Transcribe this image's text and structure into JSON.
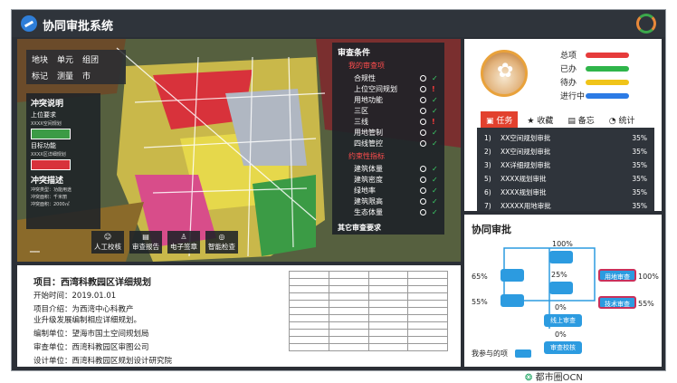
{
  "app": {
    "title": "协同审批系统"
  },
  "map_toolbox": {
    "row1": [
      "地块",
      "单元",
      "组团"
    ],
    "row2": [
      "标记",
      "测量",
      "市"
    ]
  },
  "conflict": {
    "title": "冲突说明",
    "upper_label": "上位要求",
    "upper_sub": "XXXX空间规划",
    "target_label": "目标功能",
    "target_sub": "XXXX区详细规划",
    "desc_label": "冲突描述",
    "desc_lines": [
      "冲突类型：功能用途",
      "冲突面积：千米丽",
      "冲突面积：2000㎡"
    ]
  },
  "review": {
    "title": "审查条件",
    "section1": "我的审查项",
    "items1": [
      {
        "label": "合规性",
        "status": "ok"
      },
      {
        "label": "上位空间规划",
        "status": "warn"
      },
      {
        "label": "用地功能",
        "status": "ok"
      },
      {
        "label": "三区",
        "status": "ok"
      },
      {
        "label": "三线",
        "status": "warn"
      },
      {
        "label": "用地管制",
        "status": "ok"
      },
      {
        "label": "四线管控",
        "status": "ok"
      }
    ],
    "section2": "约束性指标",
    "items2": [
      {
        "label": "建筑体量",
        "status": "ok"
      },
      {
        "label": "建筑密度",
        "status": "ok"
      },
      {
        "label": "绿地率",
        "status": "ok"
      },
      {
        "label": "建筑限高",
        "status": "ok"
      },
      {
        "label": "生态体量",
        "status": "ok"
      }
    ],
    "other": "其它审查要求"
  },
  "map_tools": [
    {
      "label": "人工校核",
      "icon": "person-icon"
    },
    {
      "label": "审查报告",
      "icon": "report-icon"
    },
    {
      "label": "电子签章",
      "icon": "stamp-icon"
    },
    {
      "label": "智能检查",
      "icon": "check-icon"
    }
  ],
  "status_legend": [
    {
      "label": "总项",
      "color": "#e63b3b"
    },
    {
      "label": "已办",
      "color": "#2fb54a"
    },
    {
      "label": "待办",
      "color": "#f0c419"
    },
    {
      "label": "进行中",
      "color": "#2c7be5"
    }
  ],
  "tabs": [
    "任务",
    "收藏",
    "备忘",
    "统计"
  ],
  "tasks": [
    {
      "n": "1)",
      "name": "XX空间规划审批",
      "pct": "35%"
    },
    {
      "n": "2)",
      "name": "XX空间规划审批",
      "pct": "35%"
    },
    {
      "n": "3)",
      "name": "XX详细规划审批",
      "pct": "35%"
    },
    {
      "n": "5)",
      "name": "XXXX规划审批",
      "pct": "35%"
    },
    {
      "n": "6)",
      "name": "XXXX规划审批",
      "pct": "35%"
    },
    {
      "n": "7)",
      "name": "XXXXX用地审批",
      "pct": "35%"
    }
  ],
  "approval": {
    "title": "协同审批",
    "p_top": "100%",
    "p_left1": "65%",
    "p_mid": "25%",
    "p_right1": "100%",
    "p_left2": "55%",
    "p_mid2": "0%",
    "p_right2": "55%",
    "p_low": "0%",
    "node_land": "用地审查",
    "node_tech": "技术审查",
    "node_online": "线上审查",
    "node_check": "审查校核",
    "mine": "我参与的项"
  },
  "project": {
    "name": "项目：西湾科教园区详细规划",
    "start": "开始时间：2019.01.01",
    "intro1": "项目介绍：为西湾中心科教产",
    "intro2": "业升级发展编制相应详细规划。",
    "org": "编制单位：望海市国土空间规划局",
    "reviewer": "审查单位：西湾科教园区审图公司",
    "designer": "设计单位：西湾科教园区规划设计研究院"
  },
  "watermark": "都市圈OCN"
}
